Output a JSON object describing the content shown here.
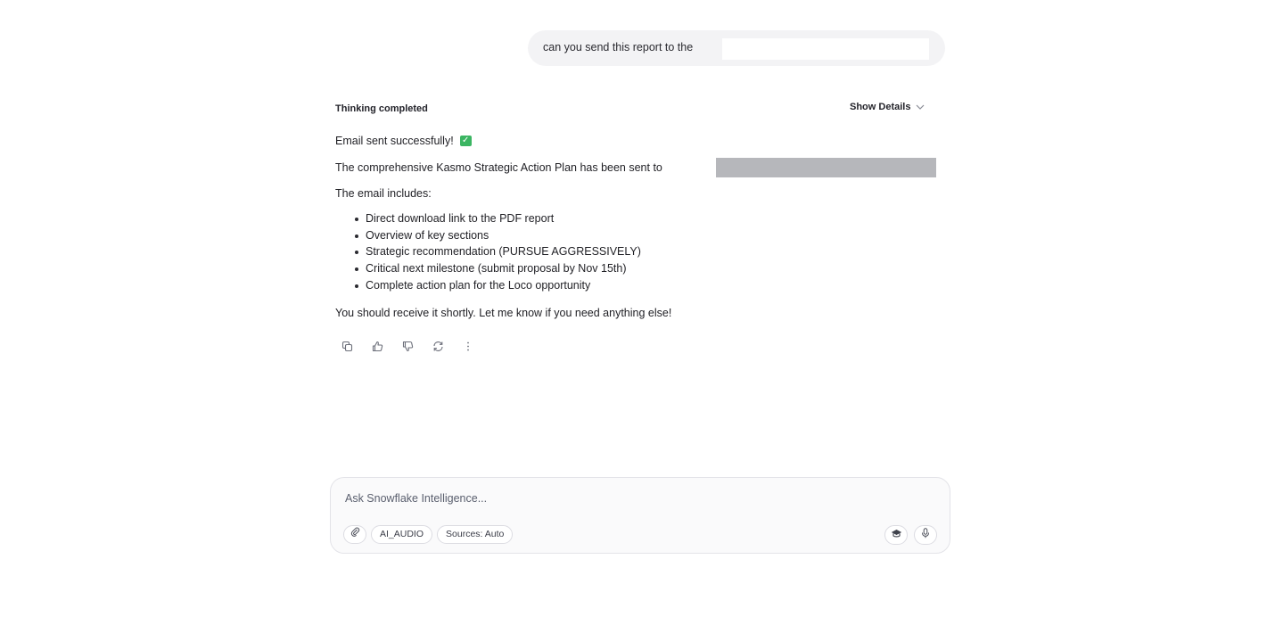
{
  "user_message": {
    "text": "can you send this report to the"
  },
  "thinking": {
    "status": "Thinking completed",
    "toggle_label": "Show Details"
  },
  "response": {
    "success_line": "Email sent successfully!",
    "sent_line": "The comprehensive Kasmo Strategic Action Plan has been sent to",
    "includes_line": "The email includes:",
    "bullets": [
      "Direct download link to the PDF report",
      "Overview of key sections",
      "Strategic recommendation (PURSUE AGGRESSIVELY)",
      "Critical next milestone (submit proposal by Nov 15th)",
      "Complete action plan for the Loco opportunity"
    ],
    "closing_line": "You should receive it shortly. Let me know if you need anything else!"
  },
  "composer": {
    "placeholder": "Ask Snowflake Intelligence...",
    "chips": [
      "AI_AUDIO",
      "Sources: Auto"
    ]
  },
  "colors": {
    "success_check": "#3bb562",
    "redaction": "#b6b7bb"
  }
}
